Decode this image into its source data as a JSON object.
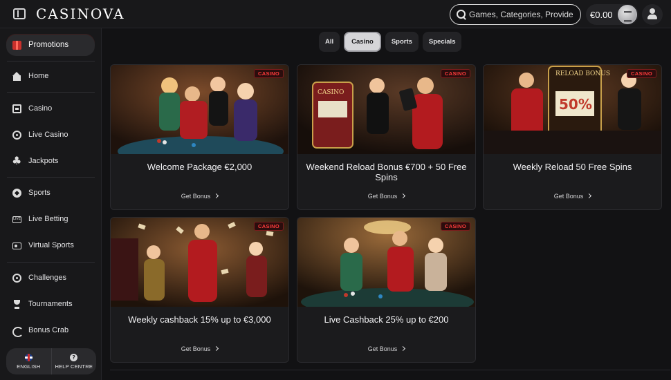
{
  "header": {
    "brand": "CASINOVA",
    "search_placeholder": "Games, Categories, Providers",
    "balance": "€0.00"
  },
  "sidebar": {
    "promotions_label": "Promotions",
    "items": [
      {
        "label": "Home",
        "icon": "home-icon"
      },
      {
        "label": "Casino",
        "icon": "slot-machine-icon"
      },
      {
        "label": "Live Casino",
        "icon": "live-casino-icon"
      },
      {
        "label": "Jackpots",
        "icon": "clover-icon"
      },
      {
        "label": "Sports",
        "icon": "soccer-ball-icon"
      },
      {
        "label": "Live Betting",
        "icon": "live-tv-icon"
      },
      {
        "label": "Virtual Sports",
        "icon": "virtual-screen-icon"
      },
      {
        "label": "Challenges",
        "icon": "target-icon"
      },
      {
        "label": "Tournaments",
        "icon": "trophy-icon"
      },
      {
        "label": "Bonus Crab",
        "icon": "claw-icon"
      }
    ],
    "footer": {
      "language_label": "ENGLISH",
      "help_label": "HELP CENTRE"
    }
  },
  "tabs": [
    {
      "label": "All",
      "active": false
    },
    {
      "label": "Casino",
      "active": true
    },
    {
      "label": "Sports",
      "active": false
    },
    {
      "label": "Specials",
      "active": false
    }
  ],
  "cards": [
    {
      "badge": "CASINO",
      "title": "Welcome Package €2,000",
      "link": "Get Bonus"
    },
    {
      "badge": "CASINO",
      "title": "Weekend Reload Bonus €700 + 50 Free Spins",
      "link": "Get Bonus"
    },
    {
      "badge": "CASINO",
      "title": "Weekly Reload 50 Free Spins",
      "link": "Get Bonus"
    },
    {
      "badge": "CASINO",
      "title": "Weekly cashback 15% up to €3,000",
      "link": "Get Bonus"
    },
    {
      "badge": "CASINO",
      "title": "Live Cashback 25% up to €200",
      "link": "Get Bonus"
    }
  ],
  "art_text": {
    "slot_sign": "CASINO",
    "reload_sign": "RELOAD BONUS",
    "reload_percent": "50%"
  },
  "colors": {
    "background": "#121214",
    "panel": "#18181a",
    "accent_red": "#ff3b3b",
    "active_tab": "#d5d5d8"
  }
}
